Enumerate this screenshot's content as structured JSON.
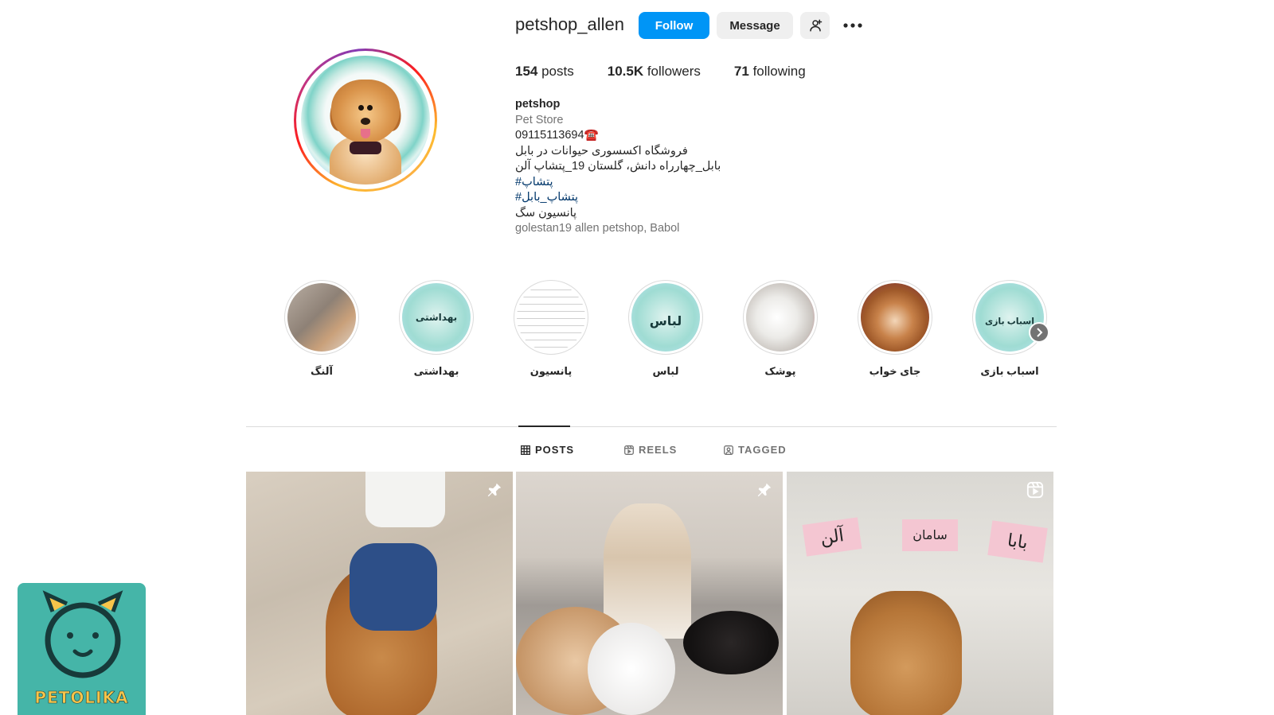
{
  "profile": {
    "username": "petshop_allen",
    "follow_label": "Follow",
    "message_label": "Message",
    "stats": {
      "posts_count": "154",
      "posts_label": " posts",
      "followers_count": "10.5K",
      "followers_label": " followers",
      "following_count": "71",
      "following_label": " following"
    },
    "bio": {
      "name": "petshop",
      "category": "Pet Store",
      "phone": "09115113694☎️",
      "line1": "فروشگاه اکسسوری حیوانات در بابل",
      "line2": "بابل_چهارراه دانش، گلستان 19_پتشاپ آلن",
      "tag1": "#پتشاپ",
      "tag2": "#پتشاپ_بابل",
      "line3": "پانسیون سگ",
      "location": "golestan19 allen petshop, Babol"
    }
  },
  "highlights": [
    {
      "label": "آلنگ"
    },
    {
      "label": "بهداشتی"
    },
    {
      "label": "پانسیون"
    },
    {
      "label": "لباس"
    },
    {
      "label": "پوشک"
    },
    {
      "label": "جای خواب"
    },
    {
      "label": "اسباب بازی"
    }
  ],
  "highlight_cover_text": {
    "hygiene": "بهداشتی",
    "clothes": "لباس",
    "toys": "اسباب بازی"
  },
  "tabs": {
    "posts": "POSTS",
    "reels": "REELS",
    "tagged": "TAGGED"
  },
  "posts": [
    {
      "icon": "pin-icon"
    },
    {
      "icon": "pin-icon"
    },
    {
      "icon": "reel-icon",
      "signs": [
        "آلن",
        "سامان",
        "بابا"
      ]
    }
  ],
  "watermark": {
    "brand": "PETOLIKA"
  },
  "colors": {
    "follow_bg": "#0095f6",
    "secondary_bg": "#efefef",
    "hashtag": "#00376b",
    "muted": "#737373",
    "watermark_bg": "#45b5a8"
  }
}
